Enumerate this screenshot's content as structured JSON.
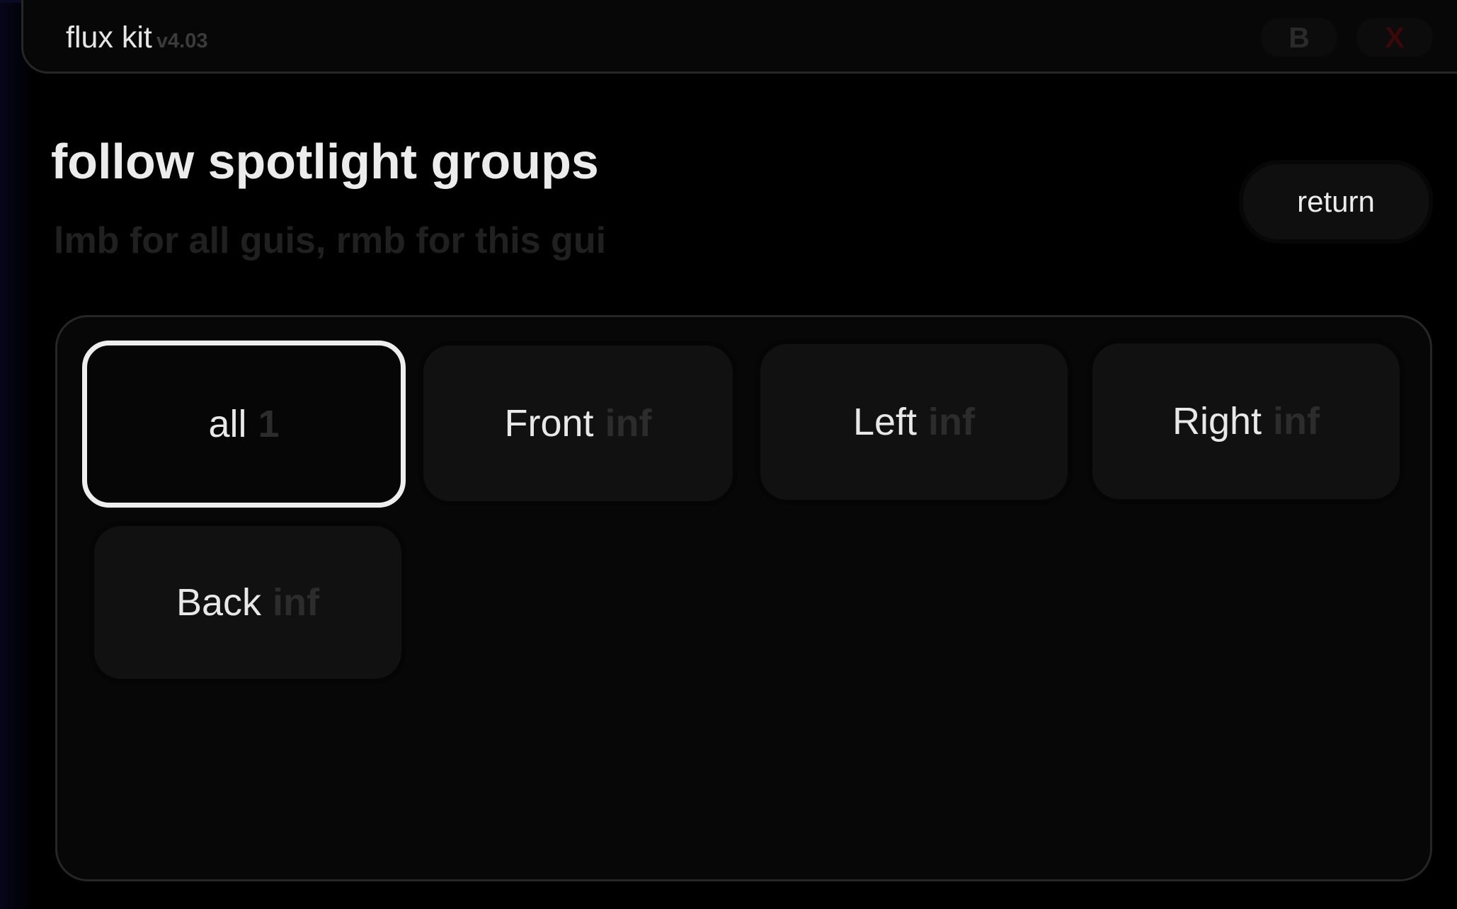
{
  "window": {
    "title": "flux kit",
    "version": "v4.03",
    "b_button": "B",
    "close_button": "X"
  },
  "page": {
    "title": "follow spotlight groups",
    "subtitle": "lmb for all guis, rmb for this gui",
    "return_label": "return"
  },
  "groups": [
    {
      "name": "all",
      "count": "1",
      "selected": true
    },
    {
      "name": "Front",
      "count": "inf",
      "selected": false
    },
    {
      "name": "Left",
      "count": "inf",
      "selected": false
    },
    {
      "name": "Right",
      "count": "inf",
      "selected": false
    },
    {
      "name": "Back",
      "count": "inf",
      "selected": false
    }
  ],
  "colors": {
    "background": "#000000",
    "panel_border": "#262626",
    "selected_border": "#eeeeee",
    "button_fill": "#111111",
    "muted_text": "#2c2c2c",
    "close_red": "#3a0808"
  }
}
